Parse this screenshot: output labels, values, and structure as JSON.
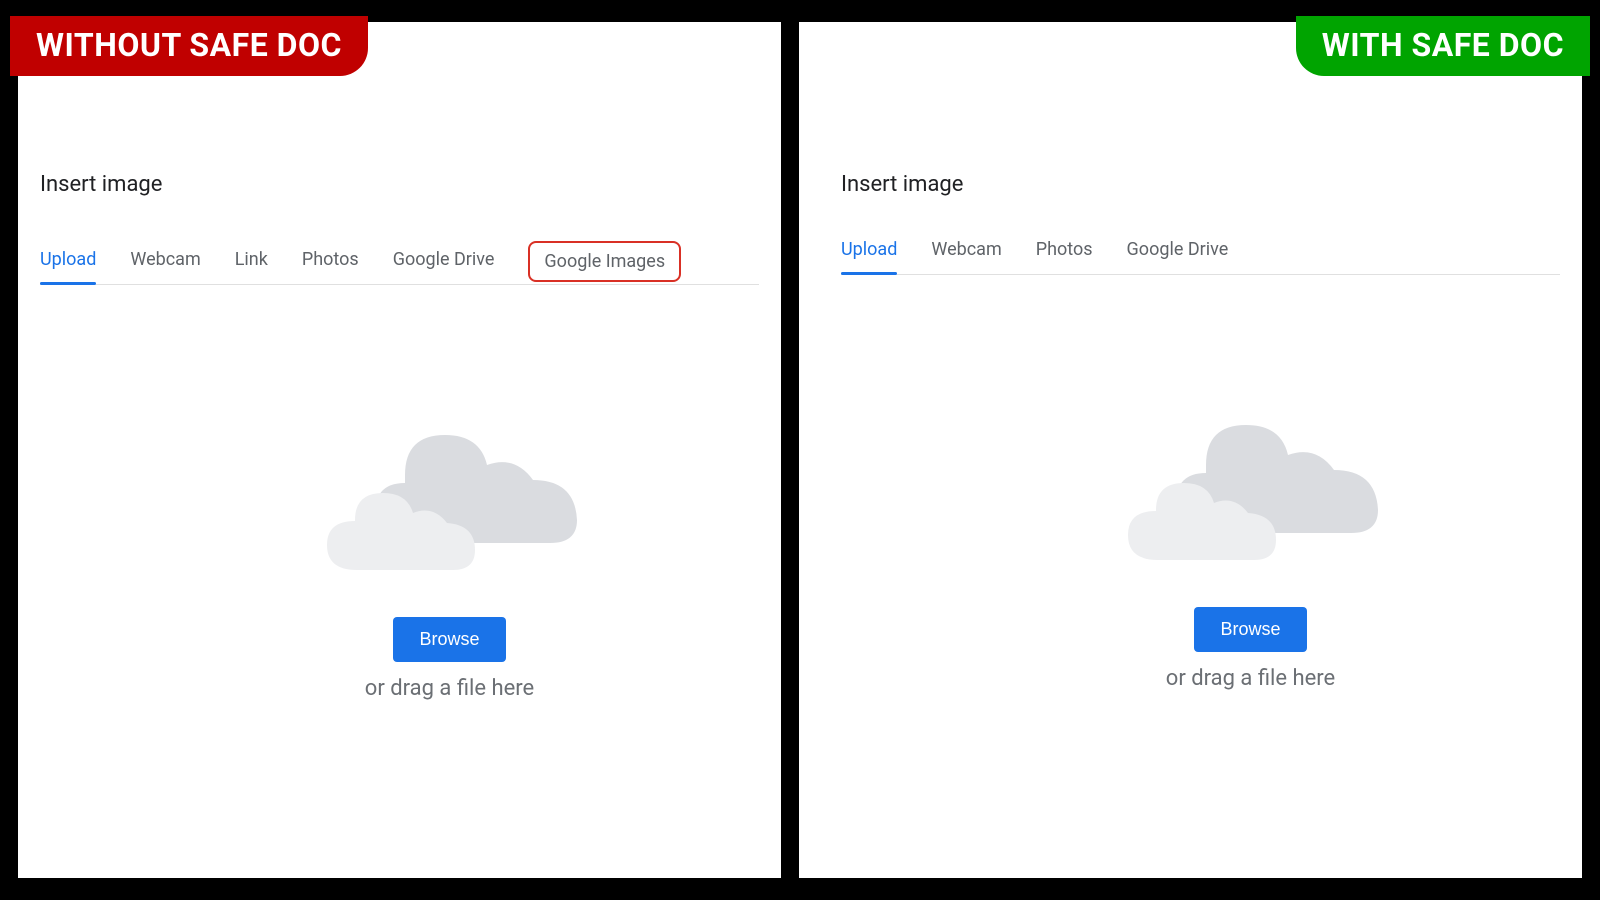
{
  "left": {
    "badge": "WITHOUT SAFE DOC",
    "title": "Insert image",
    "tabs": [
      {
        "label": "Upload",
        "active": true
      },
      {
        "label": "Webcam"
      },
      {
        "label": "Link"
      },
      {
        "label": "Photos"
      },
      {
        "label": "Google Drive"
      },
      {
        "label": "Google Images",
        "highlighted": true
      }
    ],
    "browse_label": "Browse",
    "drag_label": "or drag a file here"
  },
  "right": {
    "badge": "WITH SAFE DOC",
    "title": "Insert image",
    "tabs": [
      {
        "label": "Upload",
        "active": true
      },
      {
        "label": "Webcam"
      },
      {
        "label": "Photos"
      },
      {
        "label": "Google Drive"
      }
    ],
    "browse_label": "Browse",
    "drag_label": "or drag a file here"
  },
  "colors": {
    "badge_without": "#c00000",
    "badge_with": "#00a400",
    "accent": "#1a73e8",
    "highlight_border": "#d93025"
  }
}
